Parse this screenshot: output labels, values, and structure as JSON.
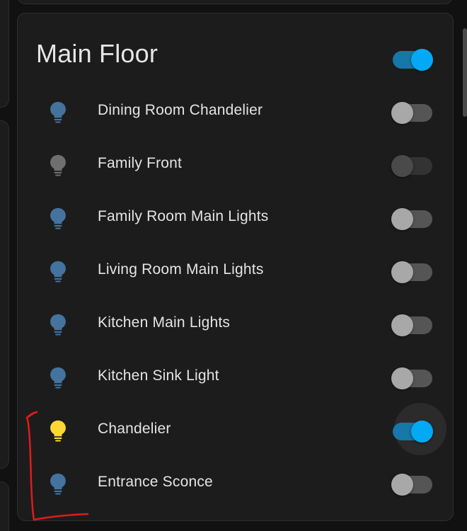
{
  "card": {
    "title": "Main Floor",
    "master_toggle_on": true
  },
  "rows": [
    {
      "label": "Dining Room Chandelier",
      "on": false,
      "available": true,
      "icon": "lightbulb-icon"
    },
    {
      "label": "Family Front",
      "on": false,
      "available": false,
      "icon": "lightbulb-icon"
    },
    {
      "label": "Family Room Main Lights",
      "on": false,
      "available": true,
      "icon": "lightbulb-icon"
    },
    {
      "label": "Living Room Main Lights",
      "on": false,
      "available": true,
      "icon": "lightbulb-icon"
    },
    {
      "label": "Kitchen Main Lights",
      "on": false,
      "available": true,
      "icon": "lightbulb-icon"
    },
    {
      "label": "Kitchen Sink Light",
      "on": false,
      "available": true,
      "icon": "lightbulb-icon"
    },
    {
      "label": "Chandelier",
      "on": true,
      "available": true,
      "icon": "lightbulb-icon"
    },
    {
      "label": "Entrance Sconce",
      "on": false,
      "available": true,
      "icon": "lightbulb-icon"
    }
  ],
  "colors": {
    "bulb_off": "#44739e",
    "bulb_on": "#fdd835",
    "bulb_unavailable": "#6f6f6f",
    "accent": "#03a9f4",
    "annotation": "#e01b1b"
  }
}
